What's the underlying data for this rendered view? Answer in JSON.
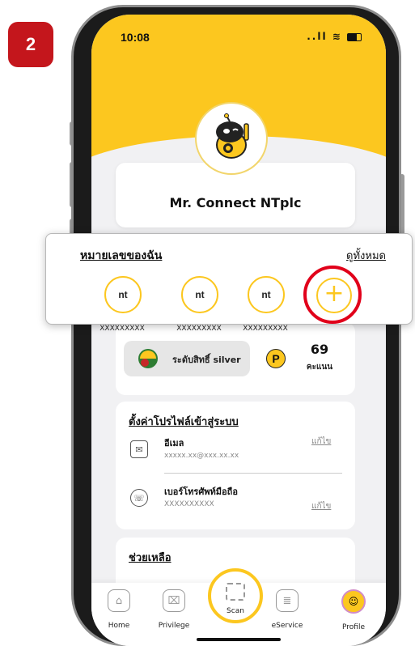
{
  "step_badge": "2",
  "status": {
    "time": "10:08",
    "signal": "..ll"
  },
  "profile": {
    "name": "Mr. Connect NTplc"
  },
  "my_numbers": {
    "title": "หมายเลขของฉัน",
    "view_all": "ดูทั้งหมด",
    "items": [
      {
        "logo": "nt",
        "number": "XXXXXXXXX"
      },
      {
        "logo": "nt",
        "number": "XXXXXXXXX"
      },
      {
        "logo": "nt",
        "number": "XXXXXXXXX"
      }
    ],
    "add_symbol": "+"
  },
  "points": {
    "tier": "ระดับสิทธิ์ silver",
    "p_symbol": "P",
    "value": "69",
    "unit": "คะแนน"
  },
  "settings": {
    "title": "ตั้งค่าโปรไฟล์เข้าสู่ระบบ",
    "email_label": "อีเมล",
    "email_value": "xxxxx.xx@xxx.xx.xx",
    "email_edit": "แก้ไข",
    "phone_label": "เบอร์โทรศัพท์มือถือ",
    "phone_value": "XXXXXXXXXX",
    "phone_edit": "แก้ไข"
  },
  "help": {
    "title": "ช่วยเหลือ"
  },
  "nav": {
    "home": "Home",
    "privilege": "Privilege",
    "scan": "Scan",
    "eservice": "eService",
    "profile": "Profile"
  },
  "colors": {
    "brand_yellow": "#fcc71f",
    "highlight_red": "#e1001a",
    "badge_red": "#c4161c"
  }
}
